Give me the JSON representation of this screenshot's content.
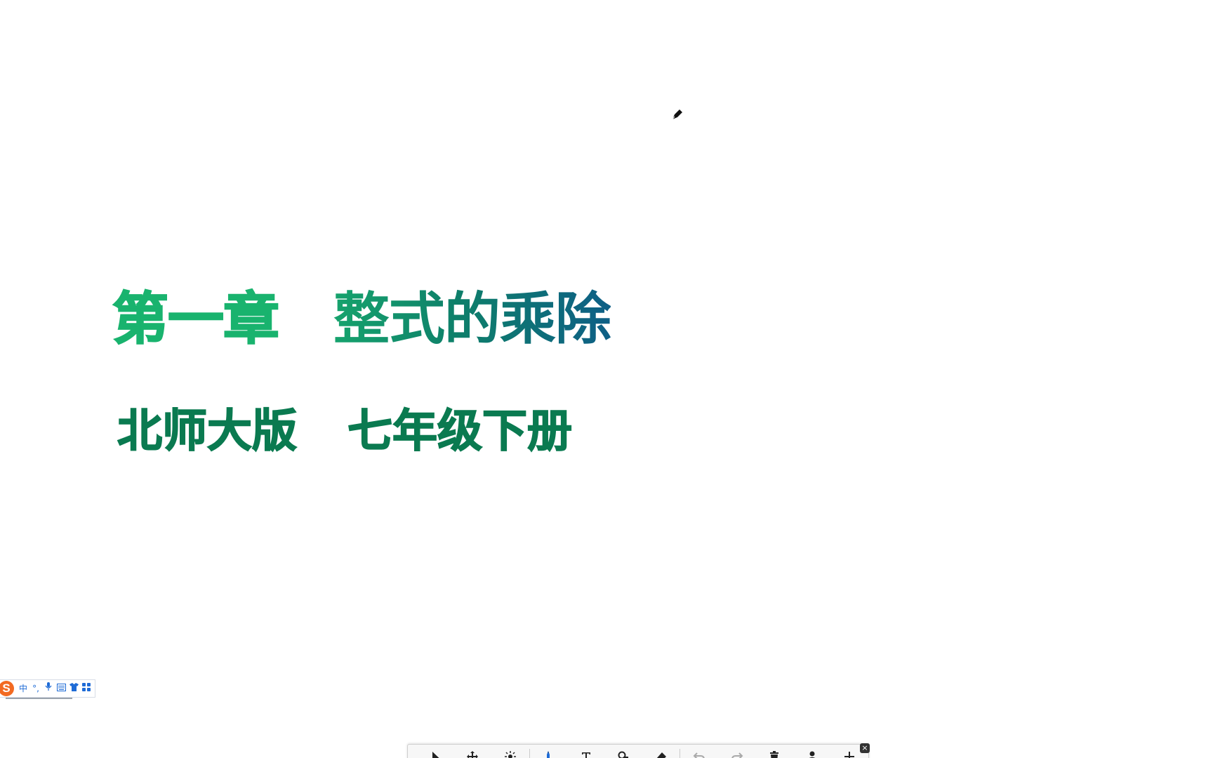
{
  "slide": {
    "title_chapter": "第一章",
    "title_topic": "整式的乘除",
    "subtitle_publisher": "北师大版",
    "subtitle_grade": "七年级下册"
  },
  "colors": {
    "chapter": "#19b36e",
    "topic_start": "#16a36d",
    "topic_end": "#0e5f86",
    "subtitle": "#0a7a50",
    "ime_logo": "#f26a21",
    "ime_icons": "#1e6bd6"
  },
  "ime_bar": {
    "logo": "S",
    "mode": "中",
    "punct": "°,",
    "items": [
      "mic-icon",
      "keyboard-icon",
      "skin-icon",
      "toolbox-icon"
    ]
  },
  "toolbar": {
    "tools": [
      "select-arrow-icon",
      "move-icon",
      "laser-pointer-icon",
      "pen-icon",
      "text-icon",
      "shape-icon",
      "eraser-icon",
      "undo-icon",
      "redo-icon",
      "clear-icon",
      "presenter-icon",
      "more-icon"
    ],
    "active_tool": "pen-icon",
    "close_label": "×"
  }
}
